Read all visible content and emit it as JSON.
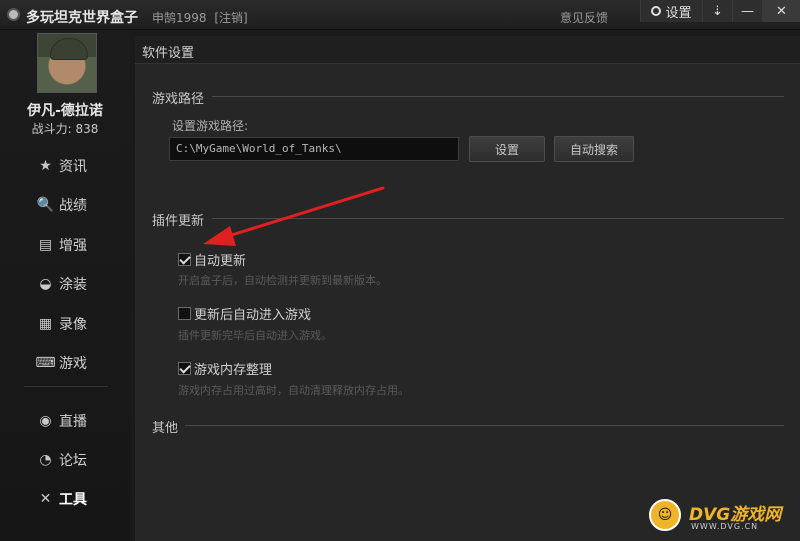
{
  "titlebar": {
    "app_title": "多玩坦克世界盒子",
    "username": "申鹄1998",
    "logout": "[注销]",
    "feedback": "意见反馈",
    "settings_label": "设置",
    "menu_glyph": "⇣",
    "min_glyph": "—",
    "close_glyph": "✕"
  },
  "sidebar": {
    "player_name": "伊凡-德拉诺",
    "power": "战斗力: 838",
    "items": [
      {
        "label": "资讯",
        "icon": "★"
      },
      {
        "label": "战绩",
        "icon": "🔍"
      },
      {
        "label": "增强",
        "icon": "▤"
      },
      {
        "label": "涂装",
        "icon": "◒"
      },
      {
        "label": "录像",
        "icon": "▦"
      },
      {
        "label": "游戏",
        "icon": "⌨"
      }
    ],
    "items2": [
      {
        "label": "直播",
        "icon": "◉"
      },
      {
        "label": "论坛",
        "icon": "◔"
      },
      {
        "label": "工具",
        "icon": "✕"
      }
    ]
  },
  "main": {
    "panel_title": "软件设置",
    "game_path": {
      "section_title": "游戏路径",
      "label": "设置游戏路径:",
      "value": "C:\\MyGame\\World_of_Tanks\\",
      "set_button": "设置",
      "auto_button": "自动搜索"
    },
    "plugin": {
      "section_title": "插件更新",
      "options": [
        {
          "label": "自动更新",
          "checked": true,
          "hint": "开启盒子后，自动检测并更新到最新版本。"
        },
        {
          "label": "更新后自动进入游戏",
          "checked": false,
          "hint": "插件更新完毕后自动进入游戏。"
        },
        {
          "label": "游戏内存整理",
          "checked": true,
          "hint": "游戏内存占用过高时，自动清理释放内存占用。"
        }
      ]
    },
    "other": {
      "section_title": "其他"
    }
  },
  "watermark": {
    "badge": "☺",
    "text": "DVG游戏网",
    "url": "WWW.DVG.CN"
  },
  "colors": {
    "accent_arrow": "#e02020",
    "background": "#262626",
    "watermark": "#f0b429"
  }
}
